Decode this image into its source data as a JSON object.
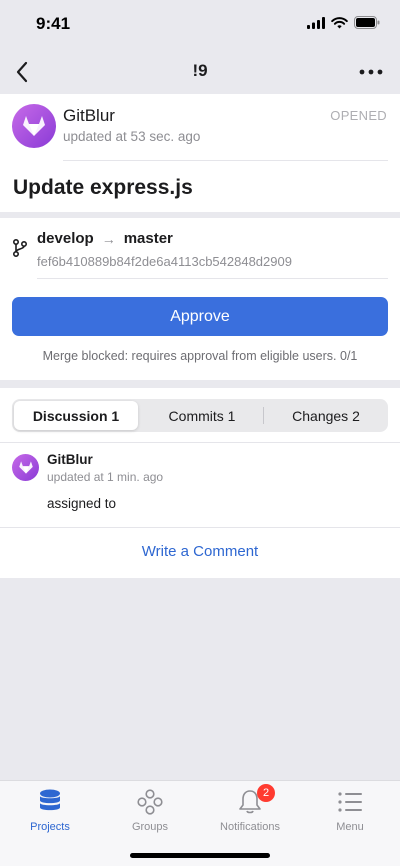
{
  "status_bar": {
    "time": "9:41"
  },
  "nav": {
    "title": "!9"
  },
  "merge_request": {
    "author": "GitBlur",
    "updated": "updated at 53 sec. ago",
    "state": "OPENED",
    "title": "Update express.js",
    "source_branch": "develop",
    "arrow": "→",
    "target_branch": "master",
    "commit_sha": "fef6b410889b84f2de6a4113cb542848d2909",
    "approve_label": "Approve",
    "merge_note": "Merge blocked: requires approval from eligible users. 0/1"
  },
  "tabs": [
    {
      "label": "Discussion 1",
      "active": true
    },
    {
      "label": "Commits 1",
      "active": false
    },
    {
      "label": "Changes 2",
      "active": false
    }
  ],
  "comment": {
    "author": "GitBlur",
    "time": "updated at 1 min. ago",
    "body": "assigned to"
  },
  "write_comment_label": "Write a Comment",
  "tab_bar": {
    "items": [
      {
        "label": "Projects",
        "icon": "database-icon",
        "active": true
      },
      {
        "label": "Groups",
        "icon": "groups-icon",
        "active": false
      },
      {
        "label": "Notifications",
        "icon": "bell-icon",
        "active": false,
        "badge": "2"
      },
      {
        "label": "Menu",
        "icon": "menu-icon",
        "active": false
      }
    ]
  },
  "colors": {
    "accent": "#3a6fdd",
    "link": "#2e67d1",
    "badge": "#ff3b30",
    "avatar": "#a855e6"
  }
}
